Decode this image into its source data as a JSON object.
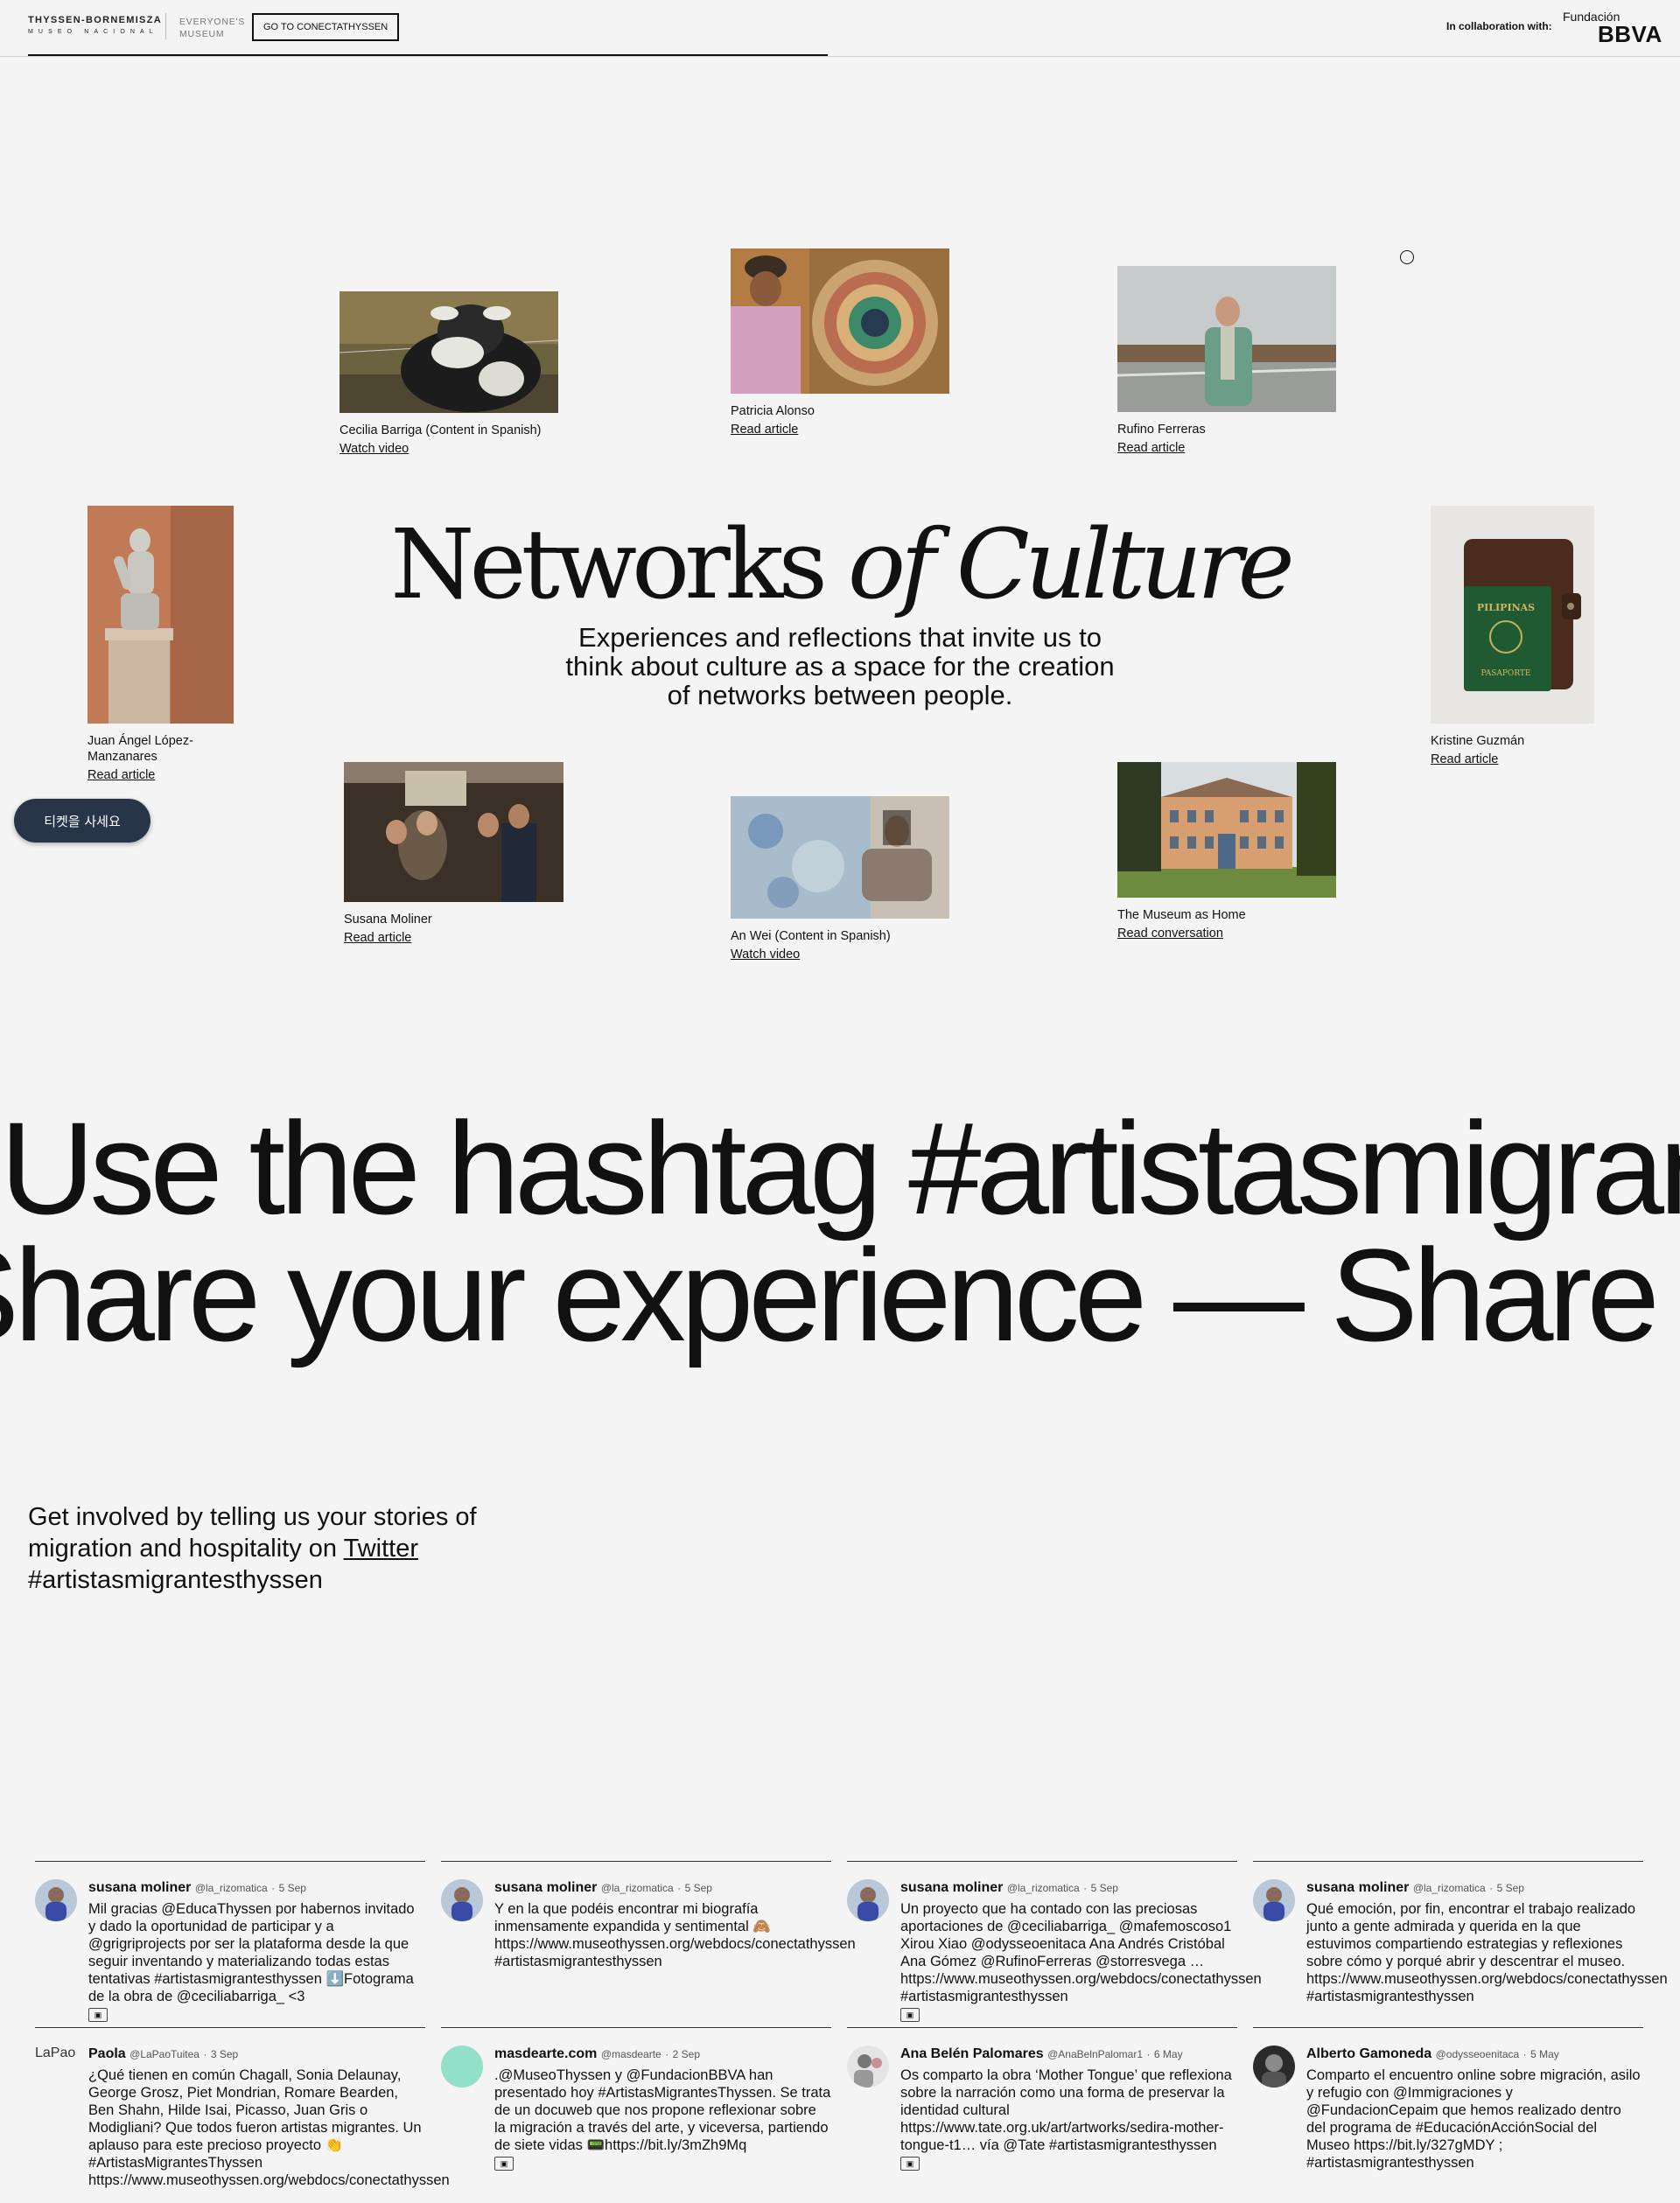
{
  "header": {
    "logo_main": "THYSSEN-BORNEMISZA",
    "logo_sub": "MUSEO NACIONAL",
    "everyones_line1": "EVERYONE'S",
    "everyones_line2": "MUSEUM",
    "conecta_button": "GO TO CONECTATHYSSEN",
    "collab_label": "In collaboration with:",
    "fundacion": "Fundación",
    "bbva": "BBVA"
  },
  "cards": [
    {
      "name": "Cecilia Barriga (Content in Spanish)",
      "link": "Watch video"
    },
    {
      "name": "Patricia Alonso",
      "link": "Read article"
    },
    {
      "name": "Rufino Ferreras",
      "link": "Read article"
    },
    {
      "name": "Juan Ángel López-Manzanares",
      "link": "Read article"
    },
    {
      "name": "Kristine Guzmán",
      "link": "Read article"
    },
    {
      "name": "Susana Moliner",
      "link": "Read article"
    },
    {
      "name": "An Wei (Content in Spanish)",
      "link": "Watch video"
    },
    {
      "name": "The Museum as Home",
      "link": "Read conversation"
    }
  ],
  "passport": {
    "top": "PILIPINAS",
    "bottom": "PASAPORTE"
  },
  "title": {
    "part1": "Networks",
    "part2": "of Culture"
  },
  "subtitle": "Experiences and reflections that invite us to think about culture as a space for the creation of networks between people.",
  "ticket_button": "티켓을 사세요",
  "marquee": {
    "line1": "Use the hashtag #artistasmigrantesthyssen",
    "line2": "Share your experience — Share your experience"
  },
  "involved": {
    "text_before": "Get involved by telling us your stories of migration and hospitality on ",
    "link": "Twitter",
    "text_after": " #artistasmigrantesthyssen"
  },
  "tweets": [
    {
      "user": "susana moliner",
      "handle": "@la_rizomatica",
      "date": "5 Sep",
      "text": "Mil gracias @EducaThyssen por habernos invitado y dado la oportunidad de participar y a @grigriprojects por ser la plataforma desde la que seguir inventando y materializando todas estas tentativas #artistasmigrantesthyssen ⬇️Fotograma de la obra de @ceciliabarriga_ <3"
    },
    {
      "user": "susana moliner",
      "handle": "@la_rizomatica",
      "date": "5 Sep",
      "text": "Y en la que podéis encontrar mi biografía inmensamente expandida y sentimental 🙈 https://www.museothyssen.org/webdocs/conectathyssen #artistasmigrantesthyssen"
    },
    {
      "user": "susana moliner",
      "handle": "@la_rizomatica",
      "date": "5 Sep",
      "text": "Un proyecto que ha contado con las preciosas aportaciones de @ceciliabarriga_ @mafemoscoso1 Xirou Xiao @odysseoenitaca Ana Andrés Cristóbal Ana Gómez @RufinoFerreras @storresvega … https://www.museothyssen.org/webdocs/conectathyssen #artistasmigrantesthyssen"
    },
    {
      "user": "susana moliner",
      "handle": "@la_rizomatica",
      "date": "5 Sep",
      "text": "Qué emoción, por fin, encontrar el trabajo realizado junto a gente admirada y querida en la que estuvimos compartiendo estrategias y reflexiones sobre cómo y porqué abrir y descentrar el museo. https://www.museothyssen.org/webdocs/conectathyssen #artistasmigrantesthyssen"
    },
    {
      "user": "Paola",
      "handle": "@LaPaoTuitea",
      "date": "3 Sep",
      "avatar_alt": "LaPao",
      "text": "¿Qué tienen en común Chagall, Sonia Delaunay, George Grosz, Piet Mondrian, Romare Bearden, Ben Shahn, Hilde Isai, Picasso, Juan Gris o Modigliani? Que todos fueron artistas migrantes. Un aplauso para este precioso proyecto 👏 #ArtistasMigrantesThyssen https://www.museothyssen.org/webdocs/conectathyssen"
    },
    {
      "user": "masdearte.com",
      "handle": "@masdearte",
      "date": "2 Sep",
      "text": ".@MuseoThyssen y @FundacionBBVA han presentado hoy #ArtistasMigrantesThyssen. Se trata de un docuweb que nos propone reflexionar sobre la migración a través del arte, y viceversa, partiendo de siete vidas 📟https://bit.ly/3mZh9Mq"
    },
    {
      "user": "Ana Belén Palomares",
      "handle": "@AnaBelnPalomar1",
      "date": "6 May",
      "text": "Os comparto la obra ‘Mother Tongue’ que reflexiona sobre la narración como una forma de preservar la identidad cultural https://www.tate.org.uk/art/artworks/sedira-mother-tongue-t1… vía @Tate #artistasmigrantesthyssen"
    },
    {
      "user": "Alberto Gamoneda",
      "handle": "@odysseoenitaca",
      "date": "5 May",
      "text": "Comparto el encuentro online sobre migración, asilo y refugio con @Immigraciones y @FundacionCepaim que hemos realizado dentro del programa de #EducaciónAcciónSocial del Museo https://bit.ly/327gMDY ; #artistasmigrantesthyssen"
    }
  ],
  "icons": [
    "media-icon",
    "cursor-ring-icon"
  ]
}
